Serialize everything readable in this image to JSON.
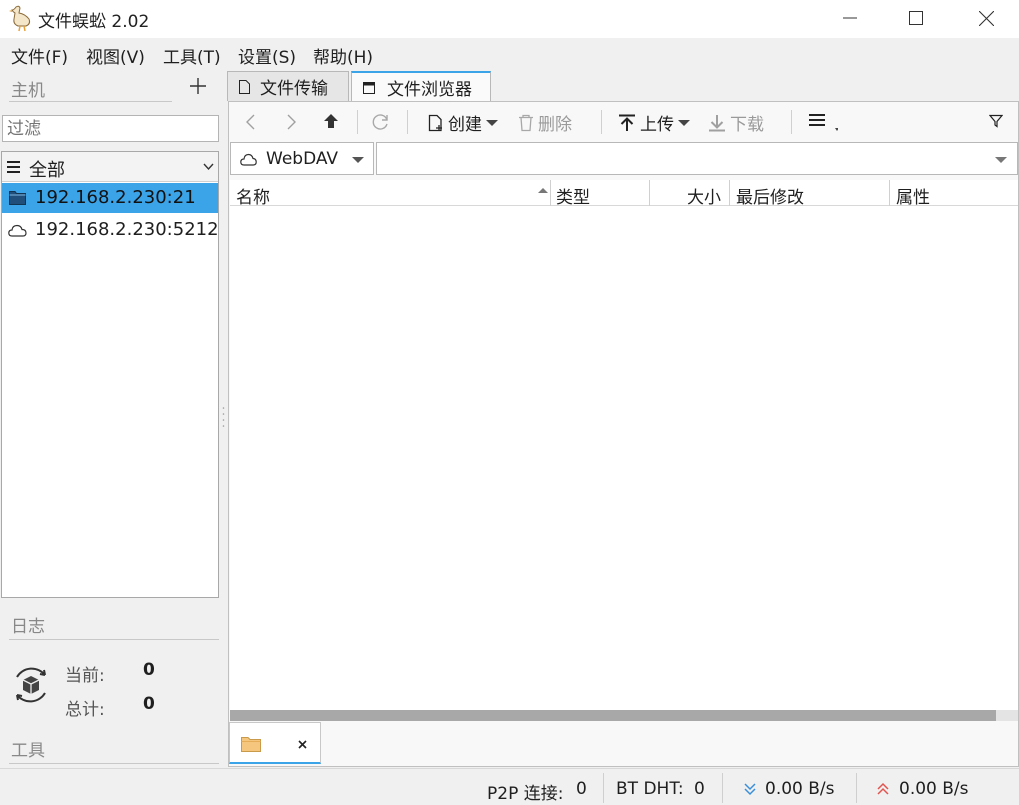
{
  "window": {
    "title": "文件蜈蚣 2.02"
  },
  "menu": [
    "文件(F)",
    "视图(V)",
    "工具(T)",
    "设置(S)",
    "帮助(H)"
  ],
  "sidebar": {
    "hosts_label": "主机",
    "filter_placeholder": "过滤",
    "group_label": "全部",
    "hosts": [
      {
        "label": "192.168.2.230:21",
        "icon": "folder-icon",
        "selected": true
      },
      {
        "label": "192.168.2.230:5212",
        "icon": "cloud-icon",
        "selected": false
      }
    ],
    "log_label": "日志",
    "stats": {
      "current_label": "当前:",
      "current_value": "0",
      "total_label": "总计:",
      "total_value": "0"
    },
    "tools_label": "工具"
  },
  "tabs": [
    {
      "label": "文件传输",
      "active": false
    },
    {
      "label": "文件浏览器",
      "active": true
    }
  ],
  "toolbar": {
    "create_label": "创建",
    "delete_label": "删除",
    "upload_label": "上传",
    "download_label": "下载"
  },
  "protocol": {
    "selected": "WebDAV"
  },
  "path": {
    "value": ""
  },
  "columns": [
    "名称",
    "类型",
    "大小",
    "最后修改",
    "属性"
  ],
  "statusbar": {
    "p2p_label": "P2P 连接:",
    "p2p_value": "0",
    "dht_label": "BT DHT:",
    "dht_value": "0",
    "download_speed": "0.00 B/s",
    "upload_speed": "0.00 B/s"
  },
  "colors": {
    "accent": "#3ba3e8",
    "download_arrow": "#3b8fd9",
    "upload_arrow": "#e0554f"
  }
}
